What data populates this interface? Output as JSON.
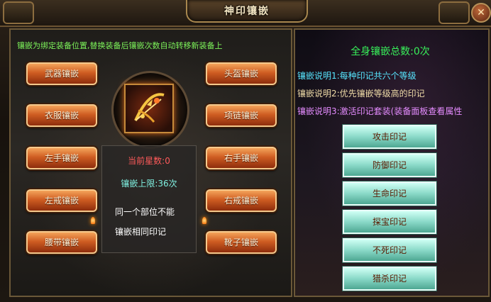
{
  "window": {
    "title": "神印镶嵌",
    "close_label": "✕"
  },
  "left": {
    "hint": "镶嵌为绑定装备位置,替换装备后镶嵌次数自动转移新装备上",
    "slots_left": [
      {
        "label": "武器镶嵌"
      },
      {
        "label": "衣服镶嵌"
      },
      {
        "label": "左手镶嵌"
      },
      {
        "label": "左戒镶嵌"
      },
      {
        "label": "腰带镶嵌"
      }
    ],
    "slots_right": [
      {
        "label": "头盔镶嵌"
      },
      {
        "label": "项链镶嵌"
      },
      {
        "label": "右手镶嵌"
      },
      {
        "label": "右戒镶嵌"
      },
      {
        "label": "靴子镶嵌"
      }
    ],
    "info": {
      "star_count": "当前星数:0",
      "inlay_limit": "镶嵌上限:36次",
      "note_line1": "同一个部位不能",
      "note_line2": "镶嵌相同印记"
    }
  },
  "right": {
    "total": "全身镶嵌总数:0次",
    "descriptions": [
      "镶嵌说明1:每种印记共六个等级",
      "镶嵌说明2:优先镶嵌等级高的印记",
      "镶嵌说明3:激活印记套装(装备面板查看属性"
    ],
    "marks": [
      {
        "label": "攻击印记"
      },
      {
        "label": "防御印记"
      },
      {
        "label": "生命印记"
      },
      {
        "label": "探宝印记"
      },
      {
        "label": "不死印记"
      },
      {
        "label": "猎杀印记"
      }
    ]
  },
  "colors": {
    "hint_green": "#7cf25a",
    "total_green": "#38f05a",
    "star_red": "#ff5a5a",
    "limit_cyan": "#7ff0e0",
    "desc1_cyan": "#57e6ff",
    "desc2_beige": "#f0dca8",
    "desc3_purple": "#e58cff",
    "orange_button": "#cf5d22",
    "teal_button": "#8ad9c8"
  },
  "icons": {
    "equipment_item": "golden-crossbow-icon",
    "close": "close-icon"
  }
}
